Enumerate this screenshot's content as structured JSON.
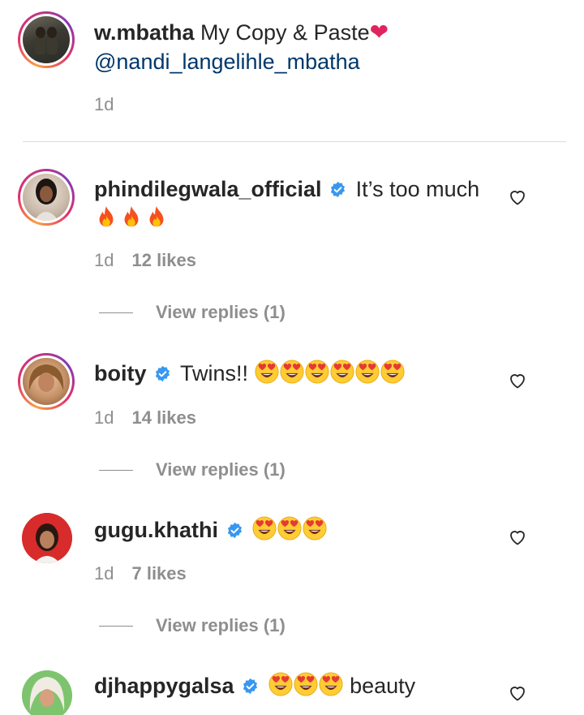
{
  "caption": {
    "username": "w.mbatha",
    "text": " My Copy & Paste",
    "heart_emoji": "❤",
    "mention": "@nandi_langelihle_mbatha",
    "time": "1d"
  },
  "comments": [
    {
      "username": "phindilegwala_official",
      "verified": true,
      "text": "It’s too much",
      "emoji": [
        "fire",
        "fire",
        "fire"
      ],
      "time": "1d",
      "likes": "12 likes",
      "replies": "View replies (1)"
    },
    {
      "username": "boity",
      "verified": true,
      "text": "Twins!!",
      "emoji": [
        "heart-eyes",
        "heart-eyes",
        "heart-eyes",
        "heart-eyes",
        "heart-eyes",
        "heart-eyes"
      ],
      "time": "1d",
      "likes": "14 likes",
      "replies": "View replies (1)"
    },
    {
      "username": "gugu.khathi",
      "verified": true,
      "text": "",
      "emoji": [
        "heart-eyes",
        "heart-eyes",
        "heart-eyes"
      ],
      "time": "1d",
      "likes": "7 likes",
      "replies": "View replies (1)"
    },
    {
      "username": "djhappygalsa",
      "verified": true,
      "text": "beauty",
      "emoji": [
        "heart-eyes",
        "heart-eyes",
        "heart-eyes"
      ]
    }
  ],
  "colors": {
    "text": "#262626",
    "meta": "#8e8e8e",
    "mention": "#00376b",
    "verified": "#3897f0",
    "divider": "#dbdbdb"
  },
  "icons": [
    "heart-outline-icon",
    "verified-badge-icon",
    "fire-emoji",
    "heart-eyes-emoji",
    "red-heart-emoji"
  ]
}
